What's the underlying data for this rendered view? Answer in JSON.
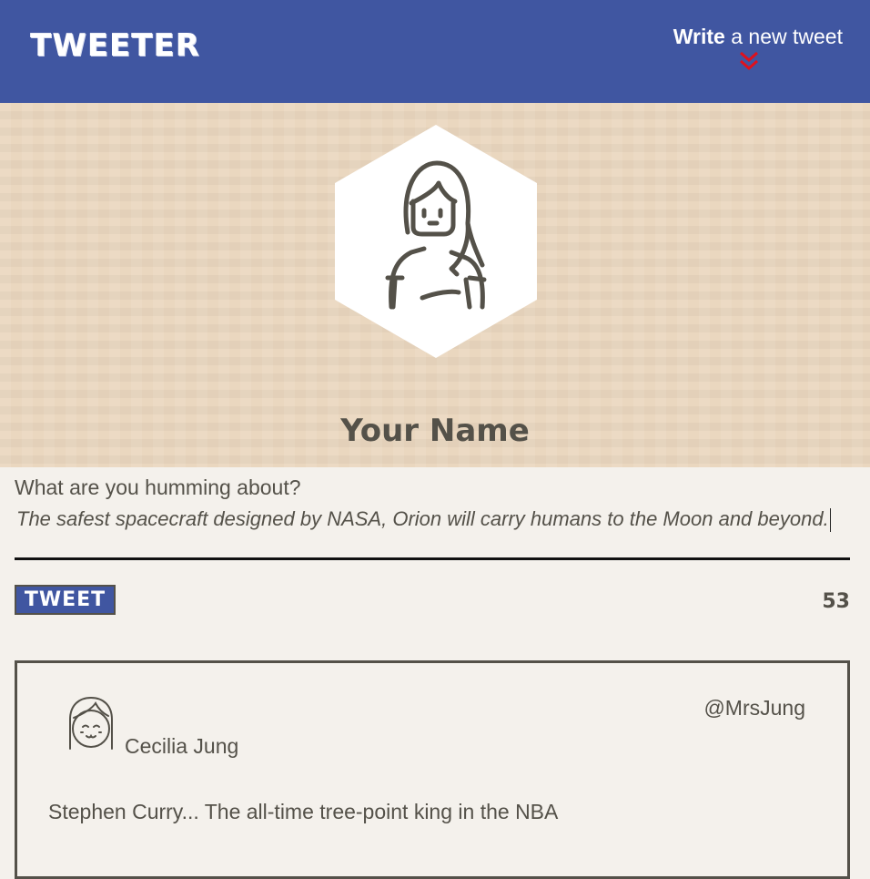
{
  "header": {
    "brand": "TWEETER",
    "compose_link": {
      "strong": "Write",
      "rest": " a new tweet"
    }
  },
  "profile": {
    "name": "Your Name"
  },
  "compose": {
    "label": "What are you humming about?",
    "text": "The safest spacecraft designed by NASA, Orion will carry humans to the Moon and beyond.",
    "button_label": "TWEET",
    "char_counter": "53"
  },
  "tweets": [
    {
      "author": "Cecilia Jung",
      "handle": "@MrsJung",
      "content": "Stephen Curry... The all-time tree-point king in the NBA"
    }
  ],
  "colors": {
    "header_bg": "#4056a1",
    "chevron_accent": "#e0101c",
    "text": "#545149",
    "page_bg": "#f4f1ec",
    "profile_bg": "#ead7bf"
  },
  "icons": {
    "profile_avatar": "woman-avatar-icon",
    "tweet_avatar": "girl-avatar-icon",
    "compose_toggle": "double-chevron-down-icon"
  }
}
